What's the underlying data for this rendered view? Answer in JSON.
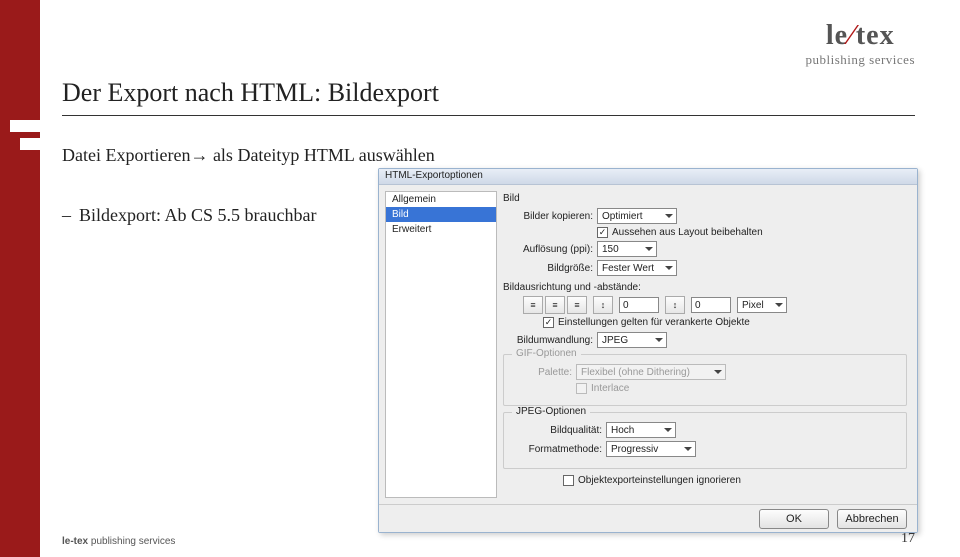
{
  "logo": {
    "main_a": "le",
    "main_b": "tex",
    "sub": "publishing services"
  },
  "slide": {
    "title": "Der Export nach HTML: Bildexport",
    "line1": "Datei Exportieren→ als Dateityp HTML auswählen",
    "bullet1": "Bildexport: Ab CS 5.5 brauchbar"
  },
  "dialog": {
    "title": "HTML-Exportoptionen",
    "side": {
      "item0": "Allgemein",
      "item1": "Bild",
      "item2": "Erweitert"
    },
    "bild": {
      "heading": "Bild",
      "copy_label": "Bilder kopieren:",
      "copy_value": "Optimiert",
      "layout_chk": "Aussehen aus Layout beibehalten",
      "res_label": "Auflösung (ppi):",
      "res_value": "150",
      "size_label": "Bildgröße:",
      "size_value": "Fester Wert",
      "align_label": "Bildausrichtung und -abstände:",
      "sp1": "0",
      "sp2": "0",
      "unit": "Pixel",
      "anchor_chk": "Einstellungen gelten für verankerte Objekte",
      "conv_label": "Bildumwandlung:",
      "conv_value": "JPEG",
      "gif": {
        "legend": "GIF-Optionen",
        "pal_label": "Palette:",
        "pal_value": "Flexibel (ohne Dithering)",
        "interlace": "Interlace"
      },
      "jpeg": {
        "legend": "JPEG-Optionen",
        "q_label": "Bildqualität:",
        "q_value": "Hoch",
        "m_label": "Formatmethode:",
        "m_value": "Progressiv"
      },
      "ignore": "Objektexporteinstellungen ignorieren"
    },
    "buttons": {
      "ok": "OK",
      "cancel": "Abbrechen"
    }
  },
  "footer": {
    "brand": "le-tex",
    "rest": " publishing services"
  },
  "page": "17"
}
